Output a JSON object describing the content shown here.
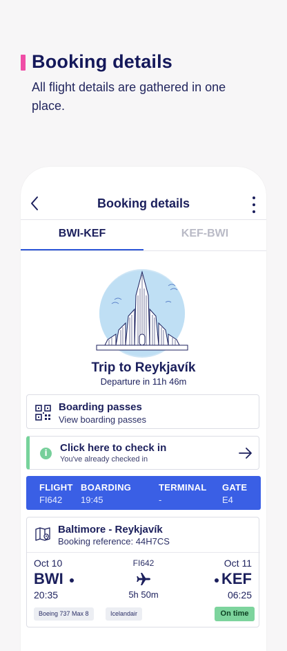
{
  "promo": {
    "title": "Booking details",
    "subtitle": "All flight details are gathered in one place."
  },
  "nav": {
    "title": "Booking details",
    "back_icon": "chevron-left-icon",
    "more_icon": "more-vertical-icon"
  },
  "tabs": [
    {
      "label": "BWI-KEF",
      "active": true
    },
    {
      "label": "KEF-BWI",
      "active": false
    }
  ],
  "trip": {
    "title": "Trip to Reykjavík",
    "departure": "Departure in 11h 46m"
  },
  "boarding_passes": {
    "title": "Boarding passes",
    "subtitle": "View boarding passes",
    "icon": "qr-code-icon"
  },
  "check_in": {
    "title": "Click here to check in",
    "subtitle": "You've already checked in",
    "icon": "info-icon"
  },
  "flight_info": {
    "flight_label": "FLIGHT",
    "flight_value": "FI642",
    "boarding_label": "BOARDING",
    "boarding_value": "19:45",
    "terminal_label": "TERMINAL",
    "terminal_value": "-",
    "gate_label": "GATE",
    "gate_value": "E4"
  },
  "route": {
    "title": "Baltimore - Reykjavík",
    "reference": "Booking reference: 44H7CS",
    "departure_date": "Oct 10",
    "arrival_date": "Oct 11",
    "flight_number": "FI642",
    "departure_code": "BWI",
    "arrival_code": "KEF",
    "departure_time": "20:35",
    "duration": "5h 50m",
    "arrival_time": "06:25",
    "aircraft": "Boeing 737 Max 8",
    "airline": "Icelandair",
    "status": "On time"
  },
  "colors": {
    "accent": "#3a5fe5",
    "navy": "#1b1f5c",
    "pink": "#ef4da6",
    "success": "#7dd49d"
  }
}
